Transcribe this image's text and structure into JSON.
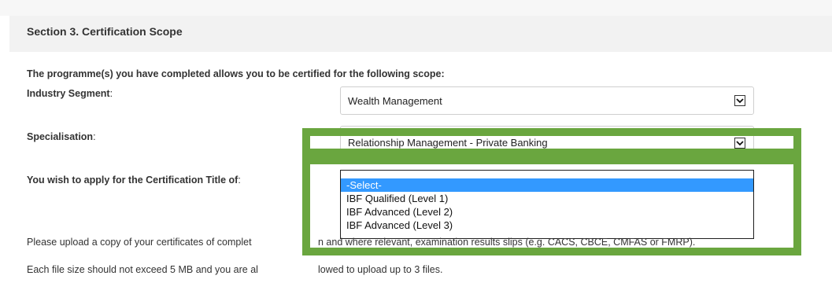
{
  "section": {
    "title": "Section 3. Certification Scope"
  },
  "intro": "The programme(s) you have completed allows you to be certified for the following scope:",
  "fields": {
    "industry_segment": {
      "label": "Industry Segment",
      "suffix": ":",
      "value": "Wealth Management"
    },
    "specialisation": {
      "label": "Specialisation",
      "suffix": ":",
      "value": "Relationship Management - Private Banking"
    },
    "certification_title": {
      "label": "You wish to apply for the Certification Title of",
      "suffix": ":",
      "options": [
        "-Select-",
        "IBF Qualified (Level 1)",
        "IBF Advanced (Level 2)",
        "IBF Advanced (Level 3)"
      ],
      "selected_index": 0
    }
  },
  "upload": {
    "note_left": "Please upload a copy of your certificates of complet",
    "note_right": "n and where relevant, examination results slips (e.g. CACS, CBCE, CMFAS or FMRP).",
    "limit_left": "Each file size should not exceed 5 MB and you are al",
    "limit_right": "lowed to upload up to 3 files."
  },
  "colors": {
    "highlight_frame": "#6aa63f",
    "selected_option": "#3399ff",
    "header_bg": "#f2f2f2"
  }
}
